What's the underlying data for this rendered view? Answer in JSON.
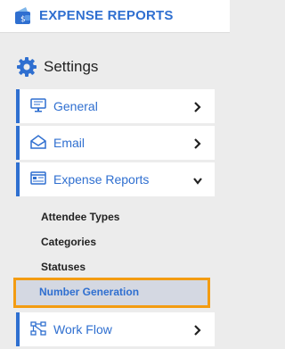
{
  "app": {
    "title": "EXPENSE REPORTS",
    "icon": "wallet-icon",
    "accent_color": "#2f6fd0"
  },
  "settings": {
    "title": "Settings",
    "icon": "gear-icon"
  },
  "nav": {
    "items": [
      {
        "label": "General",
        "icon": "monitor-icon",
        "chevron": "chevron-right-icon"
      },
      {
        "label": "Email",
        "icon": "envelope-icon",
        "chevron": "chevron-right-icon"
      },
      {
        "label": "Expense Reports",
        "icon": "report-window-icon",
        "chevron": "chevron-down-icon",
        "expanded": true
      },
      {
        "label": "Work Flow",
        "icon": "workflow-icon",
        "chevron": "chevron-right-icon"
      }
    ],
    "sub_items": [
      {
        "label": "Attendee Types"
      },
      {
        "label": "Categories"
      },
      {
        "label": "Statuses"
      },
      {
        "label": "Number Generation",
        "selected": true,
        "highlight_color": "#f39c12"
      }
    ]
  }
}
